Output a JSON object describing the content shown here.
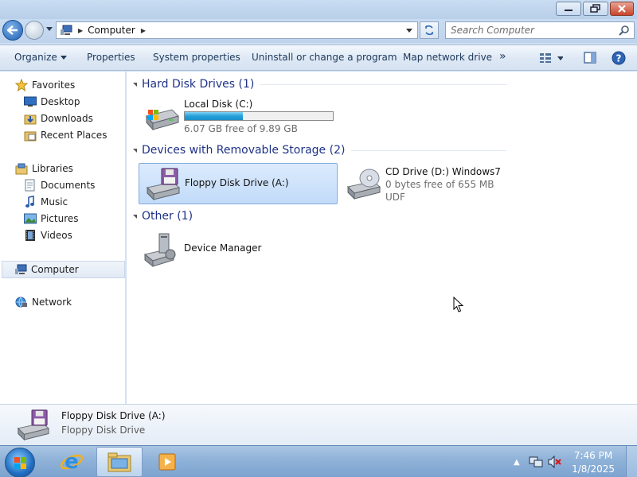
{
  "window": {
    "controls": {
      "minimize_icon": "minimize-icon",
      "maximize_icon": "restore-icon",
      "close_icon": "close-icon"
    }
  },
  "address": {
    "crumb": "Computer",
    "search_placeholder": "Search Computer"
  },
  "toolbar": {
    "organize": "Organize",
    "properties": "Properties",
    "system_properties": "System properties",
    "uninstall": "Uninstall or change a program",
    "map_drive": "Map network drive",
    "overflow": "»"
  },
  "nav": {
    "favorites": "Favorites",
    "desktop": "Desktop",
    "downloads": "Downloads",
    "recent": "Recent Places",
    "libraries": "Libraries",
    "documents": "Documents",
    "music": "Music",
    "pictures": "Pictures",
    "videos": "Videos",
    "computer": "Computer",
    "network": "Network"
  },
  "groups": {
    "hdd": "Hard Disk Drives (1)",
    "removable": "Devices with Removable Storage (2)",
    "other": "Other (1)"
  },
  "items": {
    "local_disk": {
      "name": "Local Disk (C:)",
      "free": "6.07 GB free of 9.89 GB",
      "used_fraction": 0.39
    },
    "floppy": {
      "name": "Floppy Disk Drive (A:)"
    },
    "cd": {
      "name": "CD Drive (D:) Windows7",
      "free": "0 bytes free of 655 MB",
      "fs": "UDF"
    },
    "device_manager": {
      "name": "Device Manager"
    }
  },
  "details": {
    "name": "Floppy Disk Drive (A:)",
    "type": "Floppy Disk Drive"
  },
  "taskbar": {
    "time": "7:46 PM",
    "date": "1/8/2025"
  },
  "colors": {
    "group_header": "#1e3287",
    "progress": "#25a0da",
    "selection": "#c1dbfa"
  }
}
